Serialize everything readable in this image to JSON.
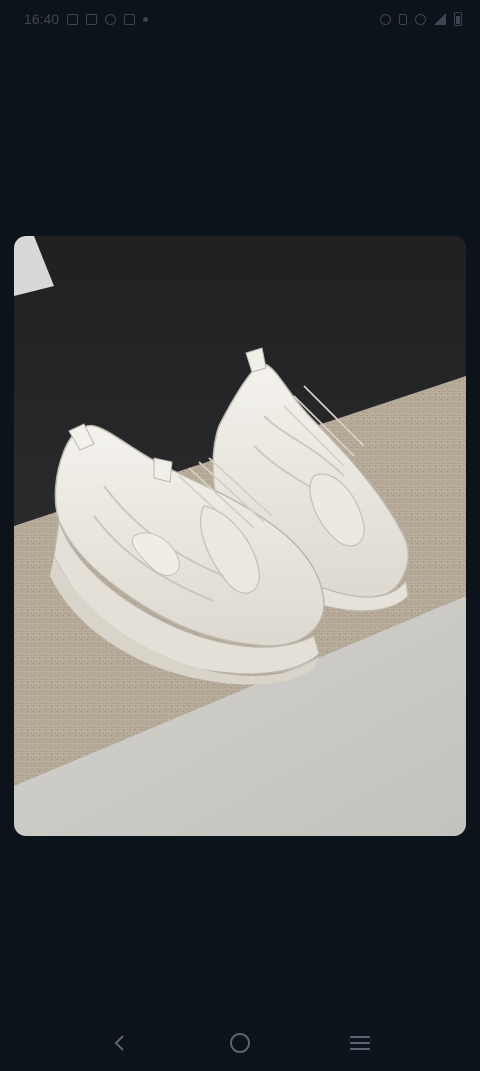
{
  "status_bar": {
    "time": "16:40",
    "icons_left": [
      "sim-icon",
      "notification-icon",
      "chat-icon",
      "instagram-icon",
      "dot-icon"
    ],
    "icons_right": [
      "alarm-icon",
      "bluetooth-icon",
      "wifi-icon",
      "signal-icon",
      "battery-icon"
    ]
  },
  "photo": {
    "subject": "white-chunky-sneakers-image",
    "background_color": "#2a2b2d",
    "surface_color": "#b9ad9b",
    "floor_color": "#cfcdc9"
  },
  "nav_bar": {
    "buttons": [
      {
        "name": "back-button",
        "icon": "chevron-left-icon"
      },
      {
        "name": "home-button",
        "icon": "circle-icon"
      },
      {
        "name": "recents-button",
        "icon": "menu-lines-icon"
      }
    ]
  },
  "colors": {
    "screen_background": "#0d131b",
    "nav_icon": "#5a6370"
  }
}
